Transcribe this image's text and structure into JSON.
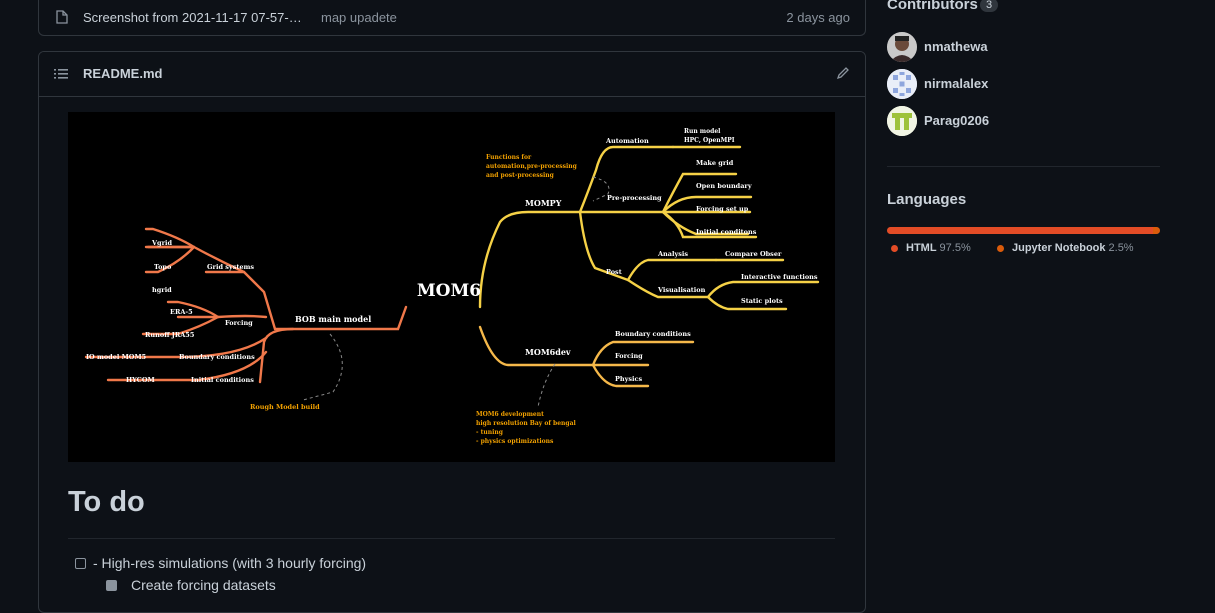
{
  "file_row": {
    "name": "Screenshot from 2021-11-17 07-57-…",
    "message": "map upadete",
    "age": "2 days ago"
  },
  "readme": {
    "title": "README.md"
  },
  "mindmap": {
    "center": "MOM6",
    "left_hub": "BOB main model",
    "left_note": "Rough Model build",
    "grid_systems": "Grid systems",
    "grid_items": [
      "Vgrid",
      "Topo",
      "hgrid"
    ],
    "forcing": "Forcing",
    "forcing_items": [
      "ERA-5",
      "Runoff JRA55"
    ],
    "boundary": "Boundary conditions",
    "boundary_item": "IO model MOM5",
    "initial": "Initial conditions",
    "initial_item": "HYCOM",
    "mompy": "MOMPY",
    "mompy_note": [
      "Functions for",
      "automation,pre-processing",
      "and post-processing"
    ],
    "automation": "Automation",
    "automation_item": [
      "Run model",
      "HPC, OpenMPI"
    ],
    "preprocessing": "Pre-processing",
    "pre_items": [
      "Make grid",
      "Open boundary",
      "Forcing set up",
      "Initial conditons"
    ],
    "post": "Post",
    "analysis": "Analysis",
    "analysis_item": "Compare Obser",
    "visualisation": "Visualisation",
    "vis_items": [
      "Interactive functions",
      "Static plots"
    ],
    "mom6dev": "MOM6dev",
    "dev_items": [
      "Boundary conditions",
      "Forcing",
      "Physics"
    ],
    "dev_note": [
      "MOM6 development",
      "high resolution Bay of bengal",
      "- tuning",
      "- physics optimizations"
    ]
  },
  "todo": {
    "heading": "To do",
    "tasks": [
      {
        "label": "- High-res simulations (with 3 hourly forcing)",
        "checked": false
      },
      {
        "label": "Create forcing datasets",
        "checked": true
      }
    ]
  },
  "sidebar": {
    "contributors_heading": "Contributors",
    "contributors_count": "3",
    "contributors": [
      {
        "name": "nmathewa"
      },
      {
        "name": "nirmalalex"
      },
      {
        "name": "Parag0206"
      }
    ],
    "languages_heading": "Languages",
    "languages": [
      {
        "name": "HTML",
        "percent": "97.5%",
        "color": "#e34c26"
      },
      {
        "name": "Jupyter Notebook",
        "percent": "2.5%",
        "color": "#DA5B0B"
      }
    ]
  },
  "colors": {
    "mindmap_left": "#f0784a",
    "mindmap_right": "#f5d146",
    "mindmap_dev": "#f5b84a",
    "note_text": "#f2a100"
  }
}
